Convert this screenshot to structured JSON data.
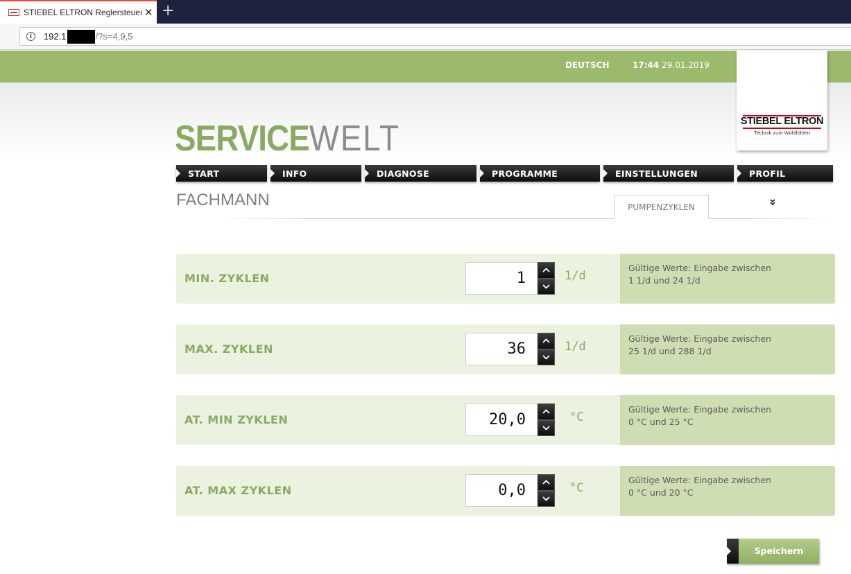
{
  "browser": {
    "tab_title": "STIEBEL ELTRON Reglersteuerung",
    "url_host": "192.1",
    "url_rest": "/?s=4,9,5"
  },
  "header": {
    "language": "DEUTSCH",
    "time": "17:44",
    "date": "29.01.2019",
    "logo_name": "STIEBEL ELTRON",
    "logo_tagline": "Technik zum Wohlfühlen",
    "brand_part1": "SERVICE",
    "brand_part2": "WELT"
  },
  "nav": {
    "items": [
      "START",
      "INFO",
      "DIAGNOSE",
      "PROGRAMME",
      "EINSTELLUNGEN",
      "PROFIL"
    ]
  },
  "page": {
    "title": "FACHMANN",
    "subtab": "PUMPENZYKLEN"
  },
  "rows": [
    {
      "label": "MIN. ZYKLEN",
      "value": "1",
      "unit": "1/d",
      "hint_line1": "Gültige Werte: Eingabe zwischen",
      "hint_line2": "1 1/d und 24 1/d"
    },
    {
      "label": "MAX. ZYKLEN",
      "value": "36",
      "unit": "1/d",
      "hint_line1": "Gültige Werte: Eingabe zwischen",
      "hint_line2": "25 1/d und 288 1/d"
    },
    {
      "label": "AT. MIN ZYKLEN",
      "value": "20,0",
      "unit": "°C",
      "hint_line1": "Gültige Werte: Eingabe zwischen",
      "hint_line2": "0 °C und 25 °C"
    },
    {
      "label": "AT. MAX ZYKLEN",
      "value": "0,0",
      "unit": "°C",
      "hint_line1": "Gültige Werte: Eingabe zwischen",
      "hint_line2": "0 °C und 20 °C"
    }
  ],
  "actions": {
    "save_label": "Speichern"
  },
  "colors": {
    "accent_green": "#9cba6c",
    "label_green": "#8aa963",
    "row_bg": "#ebf2e0",
    "hint_bg": "#cfddb3"
  }
}
